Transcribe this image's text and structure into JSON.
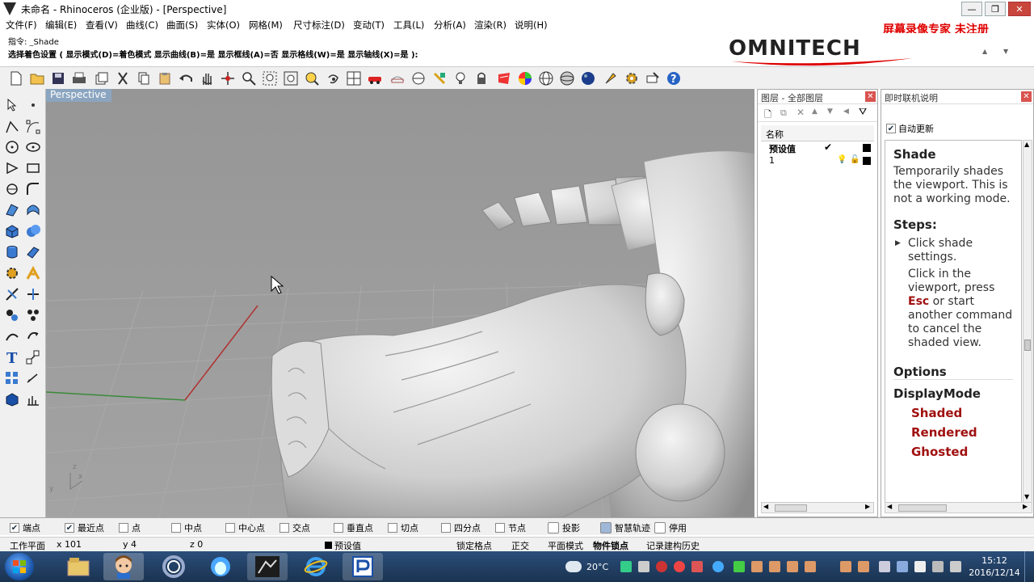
{
  "window": {
    "title": "未命名 - Rhinoceros (企业版) - [Perspective]",
    "minimize_label": "—",
    "restore_label": "❐",
    "close_label": "✕"
  },
  "menu": [
    "文件(F)",
    "编辑(E)",
    "查看(V)",
    "曲线(C)",
    "曲面(S)",
    "实体(O)",
    "网格(M)",
    "尺寸标注(D)",
    "变动(T)",
    "工具(L)",
    "分析(A)",
    "渲染(R)",
    "说明(H)"
  ],
  "watermark": "屏幕录像专家 未注册",
  "brand_logo": "OMNITECH",
  "command": {
    "prompt_line": "指令: _Shade",
    "options_line": "选择着色设置 ( 显示模式(D)=着色模式  显示曲线(B)=是  显示框线(A)=否  显示格线(W)=是  显示轴线(X)=是 ):"
  },
  "viewport": {
    "label": "Perspective"
  },
  "layers_panel": {
    "title": "图层 - 全部图层",
    "column_name": "名称",
    "rows": [
      {
        "name": "预设值",
        "check": "✔"
      },
      {
        "name": "1",
        "check": ""
      }
    ]
  },
  "help_panel": {
    "title": "即时联机说明",
    "auto_update_label": "自动更新",
    "heading": "Shade",
    "description": "Temporarily shades the viewport. This is not a working mode.",
    "steps_heading": "Steps:",
    "step1": "Click shade settings.",
    "step2_before": "Click in the viewport, press ",
    "step2_key": "Esc",
    "step2_after": " or start another command to cancel the shaded view.",
    "options_heading": "Options",
    "displaymode_heading": "DisplayMode",
    "modes": [
      "Shaded",
      "Rendered",
      "Ghosted"
    ]
  },
  "snaps": [
    {
      "label": "端点",
      "checked": true
    },
    {
      "label": "最近点",
      "checked": true
    },
    {
      "label": "点",
      "checked": false
    },
    {
      "label": "中点",
      "checked": false
    },
    {
      "label": "中心点",
      "checked": false
    },
    {
      "label": "交点",
      "checked": false
    },
    {
      "label": "垂直点",
      "checked": false
    },
    {
      "label": "切点",
      "checked": false
    },
    {
      "label": "四分点",
      "checked": false
    },
    {
      "label": "节点",
      "checked": false
    },
    {
      "label": "投影",
      "checked": false
    },
    {
      "label": "智慧轨迹",
      "checked": false
    },
    {
      "label": "停用",
      "checked": false
    }
  ],
  "status": {
    "cplane": "工作平面",
    "x": "x 101",
    "y": "y 4",
    "z": "z 0",
    "layer": "预设值",
    "grid_snap": "锁定格点",
    "ortho": "正交",
    "planar": "平面模式",
    "osnap": "物件锁点",
    "history": "记录建构历史"
  },
  "taskbar": {
    "weather": "20°C",
    "time": "15:12",
    "date": "2016/12/14"
  },
  "colors": {
    "viewport_bg": "#9a9a9a",
    "label_bg": "#8ba5c0",
    "help_red": "#a01010",
    "watermark_red": "#e00000"
  }
}
